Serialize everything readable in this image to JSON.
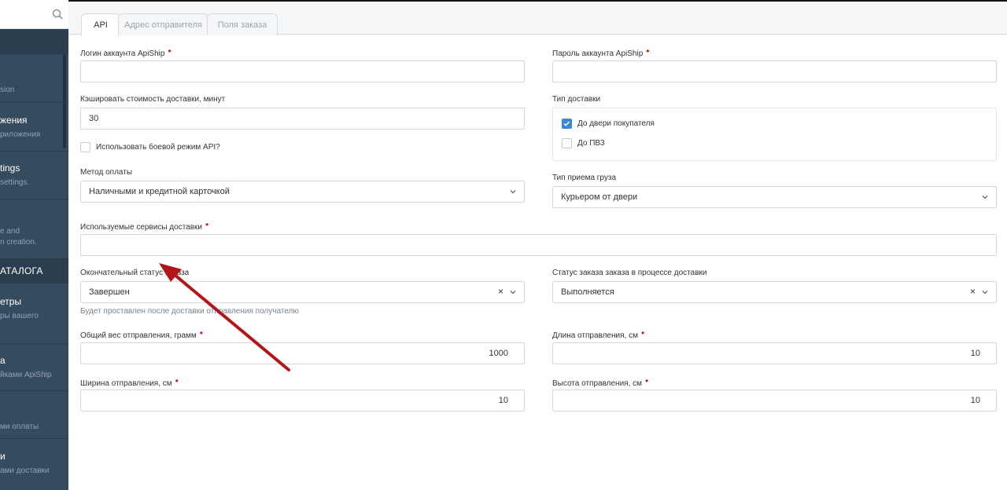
{
  "sidebar": {
    "items": [
      {
        "title": "",
        "subtitle": "sion"
      },
      {
        "title": "жения",
        "subtitle": "риложения"
      },
      {
        "title": "tings",
        "subtitle": "settings."
      },
      {
        "title": "",
        "subtitle": "e and\nn creation."
      },
      {
        "title": "етры",
        "subtitle": "ры вашего"
      },
      {
        "title": "а",
        "subtitle": "йками ApiShip"
      },
      {
        "title": "",
        "subtitle": "ми оплаты"
      },
      {
        "title": "и",
        "subtitle": "ами доставки"
      }
    ],
    "section": "АТАЛОГА"
  },
  "tabs": [
    {
      "label": "API"
    },
    {
      "label": "Адрес отправителя"
    },
    {
      "label": "Поля заказа"
    }
  ],
  "form": {
    "login": {
      "label": "Логин аккаунта ApiShip",
      "value": ""
    },
    "password": {
      "label": "Пароль аккаунта ApiShip",
      "value": ""
    },
    "cache": {
      "label": "Кэшировать стоимость доставки, минут",
      "value": "30"
    },
    "combat_mode": {
      "label": "Использовать боевой режим API?"
    },
    "delivery_type": {
      "label": "Тип доставки",
      "options": [
        {
          "label": "До двери покупателя",
          "checked": true
        },
        {
          "label": "До ПВЗ",
          "checked": false
        }
      ]
    },
    "payment_method": {
      "label": "Метод оплаты",
      "value": "Наличными и кредитной карточкой"
    },
    "pickup_type": {
      "label": "Тип приема груза",
      "value": "Курьером от двери"
    },
    "services": {
      "label": "Используемые сервисы доставки",
      "value": ""
    },
    "final_status": {
      "label": "Окончательный статус заказа",
      "value": "Завершен",
      "hint": "Будет проставлен после доставки отправления получателю"
    },
    "delivery_status": {
      "label": "Статус заказа заказа в процессе доставки",
      "value": "Выполняется"
    },
    "weight": {
      "label": "Общий вес отправления, грамм",
      "value": "1000"
    },
    "length": {
      "label": "Длина отправления, см",
      "value": "10"
    },
    "width": {
      "label": "Ширина отправления, см",
      "value": "10"
    },
    "height": {
      "label": "Высота отправления, см",
      "value": "10"
    }
  },
  "icons": {
    "search": "search-icon",
    "chevron": "chevron-down-icon",
    "clear": "×",
    "check": "checkmark-icon"
  },
  "colors": {
    "sidebar": "#354b5e",
    "accent": "#3b86d6",
    "required": "#c01c1c",
    "arrow": "#b3141a"
  }
}
